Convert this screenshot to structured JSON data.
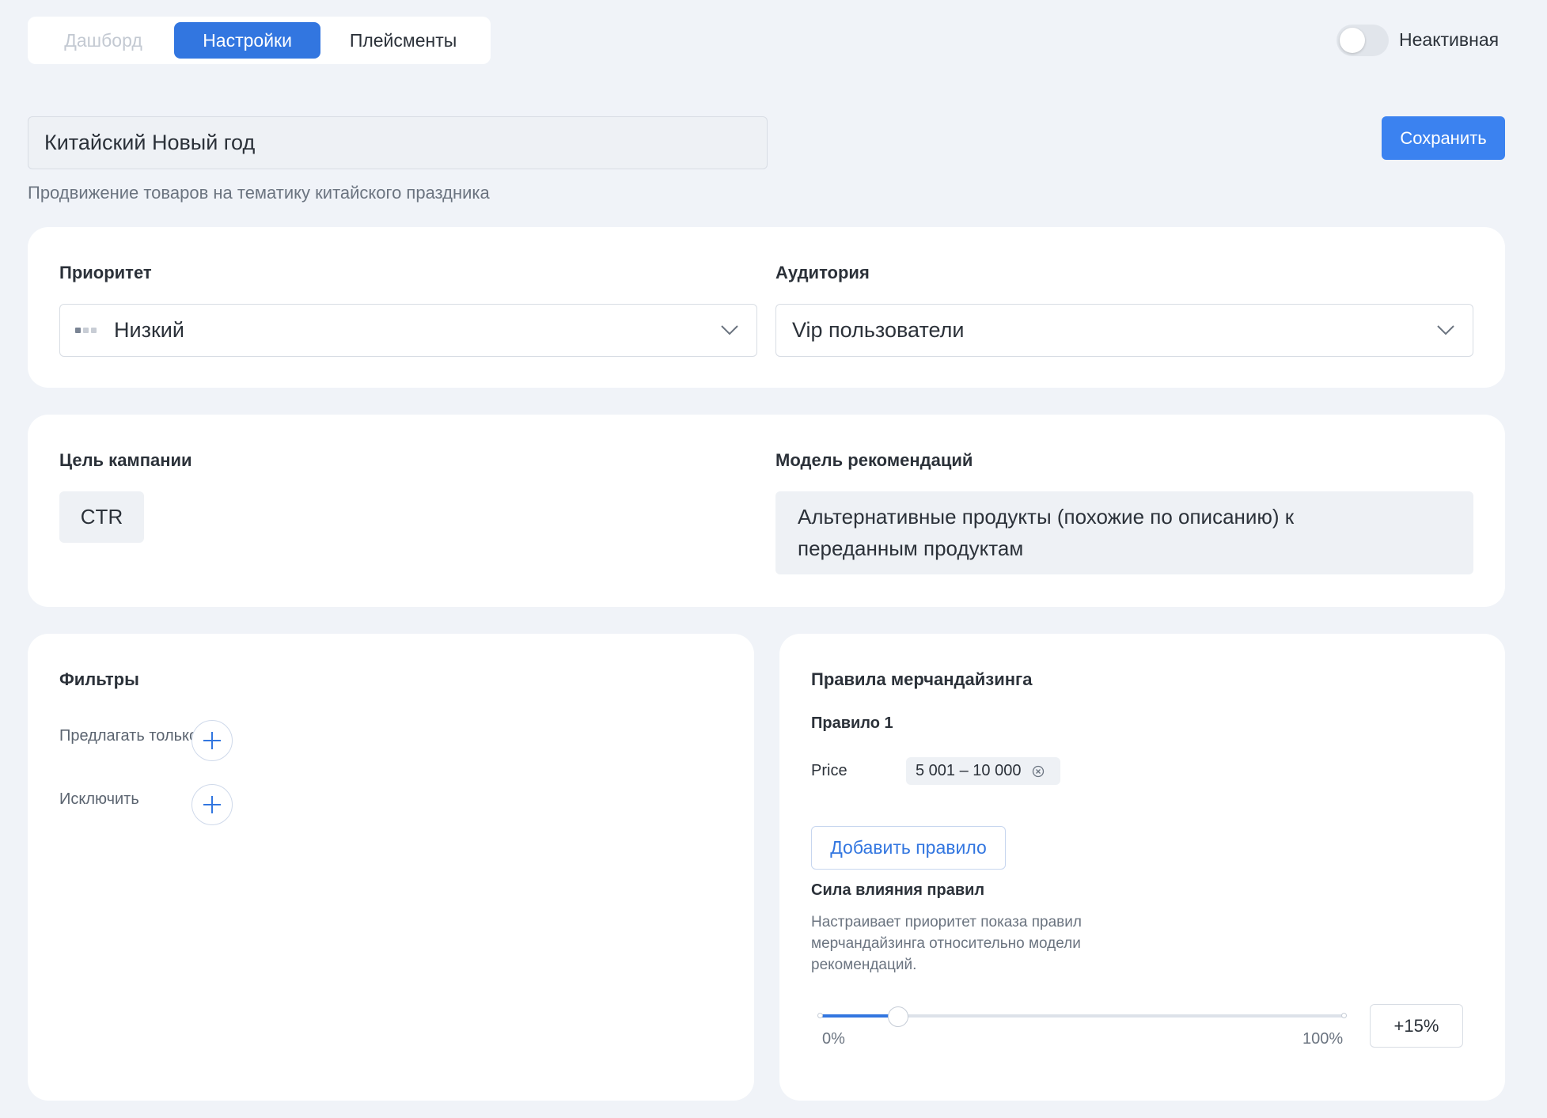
{
  "tabs": [
    {
      "label": "Дашборд",
      "state": "disabled"
    },
    {
      "label": "Настройки",
      "state": "active"
    },
    {
      "label": "Плейсменты",
      "state": "normal"
    }
  ],
  "status": {
    "label": "Неактивная",
    "active": false
  },
  "campaign": {
    "name": "Китайский Новый год",
    "description": "Продвижение товаров на тематику китайского праздника"
  },
  "save_label": "Сохранить",
  "priority": {
    "label": "Приоритет",
    "value": "Низкий",
    "icon": "priority-low-icon",
    "dot_colors": [
      "#7a8494",
      "#c8cdd5",
      "#c8cdd5"
    ]
  },
  "audience": {
    "label": "Аудитория",
    "value": "Vip пользователи"
  },
  "goal": {
    "label": "Цель кампании",
    "value": "CTR"
  },
  "model": {
    "label": "Модель рекомендаций",
    "value_line1": "Альтернативные продукты (похожие по описанию) к",
    "value_line2": "переданным продуктам"
  },
  "filters": {
    "title": "Фильтры",
    "offer_only": "Предлагать только",
    "exclude": "Исключить"
  },
  "merch": {
    "title": "Правила мерчандайзинга",
    "rule_title": "Правило 1",
    "price_label": "Price",
    "price_value": "5 001 – 10 000",
    "add_rule": "Добавить правило",
    "strength_title": "Сила влияния правил",
    "strength_desc": "Настраивает приоритет показа правил мерчандайзинга относительно модели рекомендаций.",
    "slider_min": "0%",
    "slider_max": "100%",
    "slider_fraction": 0.15,
    "slider_value": "+15%"
  },
  "colors": {
    "accent": "#3276e0",
    "save_button": "#3b82f0",
    "page_bg": "#f0f3f8"
  }
}
